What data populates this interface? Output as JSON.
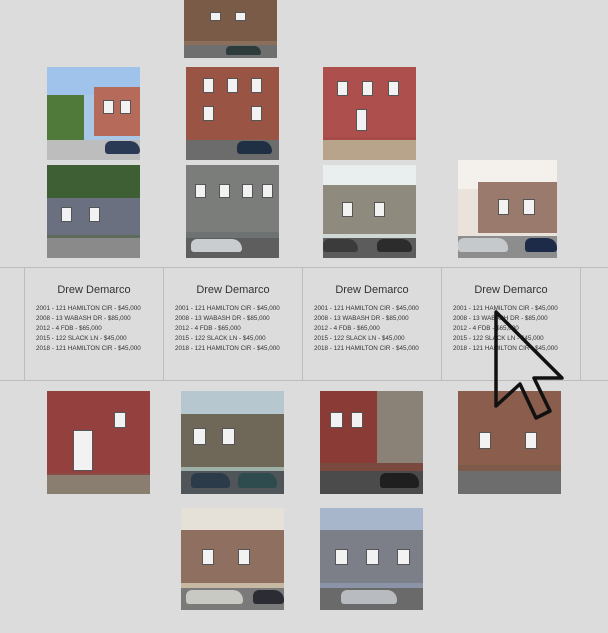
{
  "cards": [
    {
      "name": "Drew Demarco",
      "sales": [
        "2001 - 121 HAMILTON CIR - $45,000",
        "2008 - 13 WABASH DR - $85,000",
        "2012 - 4 FDB - $65,000",
        "2015 - 122 SLACK LN - $45,000",
        "2018 - 121 HAMILTON CIR - $45,000"
      ]
    },
    {
      "name": "Drew Demarco",
      "sales": [
        "2001 - 121 HAMILTON CIR - $45,000",
        "2008 - 13 WABASH DR - $85,000",
        "2012 - 4 FDB - $65,000",
        "2015 - 122 SLACK LN - $45,000",
        "2018 - 121 HAMILTON CIR - $45,000"
      ]
    },
    {
      "name": "Drew Demarco",
      "sales": [
        "2001 - 121 HAMILTON CIR - $45,000",
        "2008 - 13 WABASH DR - $85,000",
        "2012 - 4 FDB - $65,000",
        "2015 - 122 SLACK LN - $45,000",
        "2018 - 121 HAMILTON CIR - $45,000"
      ]
    },
    {
      "name": "Drew Demarco",
      "sales": [
        "2001 - 121 HAMILTON CIR - $45,000",
        "2008 - 13 WABASH DR - $85,000",
        "2012 - 4 FDB - $65,000",
        "2015 - 122 SLACK LN - $45,000",
        "2018 - 121 HAMILTON CIR - $45,000"
      ]
    }
  ],
  "colors": {
    "background": "#dcdcdc",
    "card_text": "#333333",
    "divider": "#bdbdbd"
  },
  "icons": {
    "cursor": "mouse-pointer-icon",
    "photo": "house-photo"
  }
}
